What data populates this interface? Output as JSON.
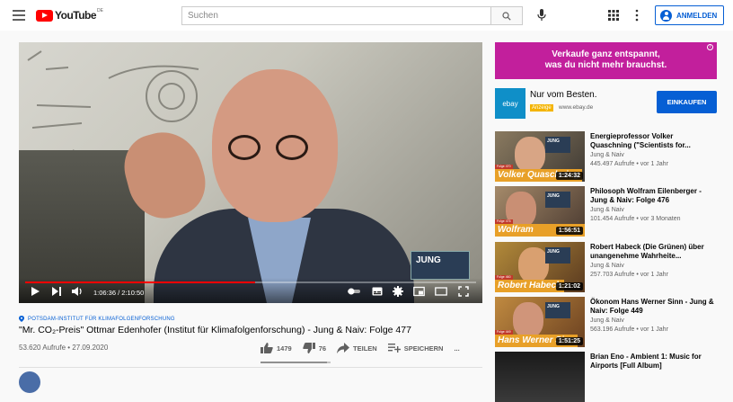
{
  "header": {
    "logo_text": "YouTube",
    "logo_country": "DE",
    "search_placeholder": "Suchen",
    "signin_label": "ANMELDEN"
  },
  "player": {
    "time_current": "1:06:36",
    "time_total": "2:10:50",
    "time_display": "1:06:36 / 2:10:50",
    "progress": 0.509,
    "overlay_logo": "JUNG"
  },
  "video": {
    "category": "POTSDAM-INSTITUT FÜR KLIMAFOLGENFORSCHUNG",
    "title": "\"Mr. CO₂-Preis\" Ottmar Edenhofer (Institut für Klimafolgenforschung) - Jung & Naiv: Folge 477",
    "meta": "53.620 Aufrufe • 27.09.2020",
    "likes": "1479",
    "dislikes": "76",
    "like_ratio": 0.951,
    "share_label": "TEILEN",
    "save_label": "SPEICHERN",
    "more_label": "..."
  },
  "ad_banner": {
    "line1": "Verkaufe ganz entspannt,",
    "line2": "was du nicht mehr brauchst.",
    "info": "i"
  },
  "ebay_ad": {
    "logo": "ebay",
    "title": "Nur vom Besten.",
    "tag": "Anzeige",
    "url": "www.ebay.de",
    "button": "EINKAUFEN"
  },
  "related": [
    {
      "title": "Energieprofessor Volker Quaschning (\"Scientists for...",
      "channel": "Jung & Naiv",
      "stats": "445.497 Aufrufe • vor 1 Jahr",
      "duration": "1:24:32",
      "nameplate": "Volker Quaschning",
      "folge": "Folge 470",
      "logo": "JUNG"
    },
    {
      "title": "Philosoph Wolfram Eilenberger - Jung & Naiv: Folge 476",
      "channel": "Jung & Naiv",
      "stats": "101.454 Aufrufe • vor 3 Monaten",
      "duration": "1:56:51",
      "nameplate": "Wolfram Eilenberger",
      "folge": "Folge 476",
      "logo": "JUNG"
    },
    {
      "title": "Robert Habeck (Die Grünen) über unangenehme Wahrheite...",
      "channel": "Jung & Naiv",
      "stats": "257.703 Aufrufe • vor 1 Jahr",
      "duration": "1:21:02",
      "nameplate": "Robert Habeck",
      "folge": "Folge 460",
      "logo": "JUNG"
    },
    {
      "title": "Ökonom Hans Werner Sinn - Jung & Naiv: Folge 449",
      "channel": "Jung & Naiv",
      "stats": "563.196 Aufrufe • vor 1 Jahr",
      "duration": "1:51:25",
      "nameplate": "Hans Werner Sinn",
      "folge": "Folge 449",
      "logo": "JUNG"
    },
    {
      "title": "Brian Eno - Ambient 1: Music for Airports [Full Album]",
      "channel": "",
      "stats": "",
      "duration": "",
      "nameplate": "",
      "folge": "",
      "logo": ""
    }
  ],
  "colors": {
    "accent": "#065fd4",
    "brand_red": "#ff0000",
    "ad_magenta": "#c21f9c",
    "nameplate_orange": "#e8a028"
  }
}
